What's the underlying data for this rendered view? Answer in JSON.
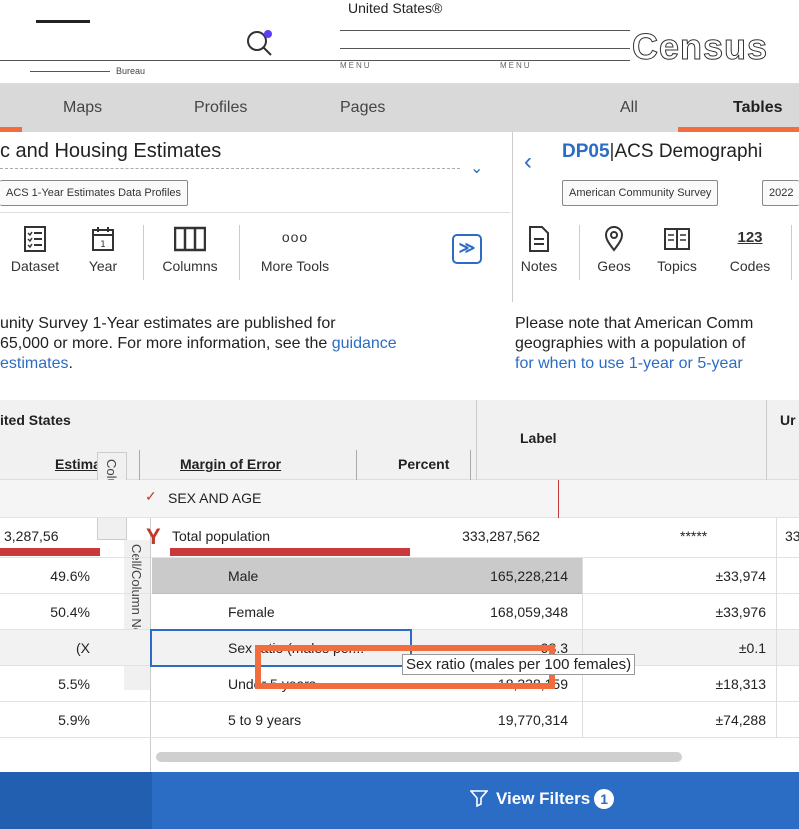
{
  "header": {
    "brand_title": "United States®",
    "brand_sub": "Bureau",
    "menu_label": "MENU",
    "menu_label_2": "MENU",
    "logo": "Census"
  },
  "tabs": {
    "maps": "Maps",
    "profiles": "Profiles",
    "pages": "Pages",
    "all": "All",
    "tables": "Tables"
  },
  "left_panel": {
    "title": "c and Housing Estimates",
    "tag": "ACS 1-Year Estimates Data Profiles",
    "tools": [
      {
        "label": "Dataset",
        "icon": "checklist-icon"
      },
      {
        "label": "Year",
        "icon": "calendar-icon"
      },
      {
        "label": "Columns",
        "icon": "columns-icon"
      },
      {
        "label": "More Tools",
        "icon": "more-icon",
        "glyph": "ooo"
      }
    ],
    "collapse_glyph": "≫",
    "para_line1": "unity Survey 1-Year estimates are published for",
    "para_line2_pre": "65,000 or more. For more information, see the ",
    "para_line2_link": "guidance",
    "para_line3_link": "estimates",
    "para_line3_post": "."
  },
  "right_panel": {
    "table_id": "DP05",
    "table_title": "ACS Demographi",
    "tags": [
      "American Community Survey",
      "2022"
    ],
    "tools": [
      {
        "label": "Notes",
        "icon": "notes-icon"
      },
      {
        "label": "Geos",
        "icon": "location-pin-icon"
      },
      {
        "label": "Topics",
        "icon": "book-icon"
      },
      {
        "label": "Codes",
        "icon": "codes-icon",
        "glyph": "123"
      }
    ],
    "para_line1": "Please note that American Comm",
    "para_line2": "geographies with a population of",
    "para_line3_link": "for when to use 1-year or 5-year"
  },
  "table": {
    "geo": "ited States",
    "geo_right": "Ur",
    "col_estimate": "Estimate",
    "col_moe": "Margin of Error",
    "col_percent": "Percent",
    "col_label": "Label",
    "side_label_columns": "Columns",
    "side_label_notes": "Cell/Column Notes",
    "section": "SEX AND AGE",
    "rows": [
      {
        "label": "Total population",
        "left": "3,287,56",
        "value": "333,287,562",
        "moe": "*****",
        "right": "33"
      },
      {
        "label": "Male",
        "left": "49.6%",
        "value": "165,228,214",
        "moe": "±33,974"
      },
      {
        "label": "Female",
        "left": "50.4%",
        "value": "168,059,348",
        "moe": "±33,976"
      },
      {
        "label": "Sex ratio (males per...",
        "left": "(X",
        "value": "98.3",
        "moe": "±0.1"
      },
      {
        "label": "Under 5 years",
        "left": "5.5%",
        "value": "18,338,159",
        "moe": "±18,313"
      },
      {
        "label": "5 to 9 years",
        "left": "5.9%",
        "value": "19,770,314",
        "moe": "±74,288"
      }
    ],
    "tooltip": "Sex ratio (males per 100 females)"
  },
  "footer": {
    "view_filters": "View Filters",
    "filter_count": "1"
  },
  "colors": {
    "accent": "#f26d3d",
    "primary": "#2b6cc4"
  }
}
